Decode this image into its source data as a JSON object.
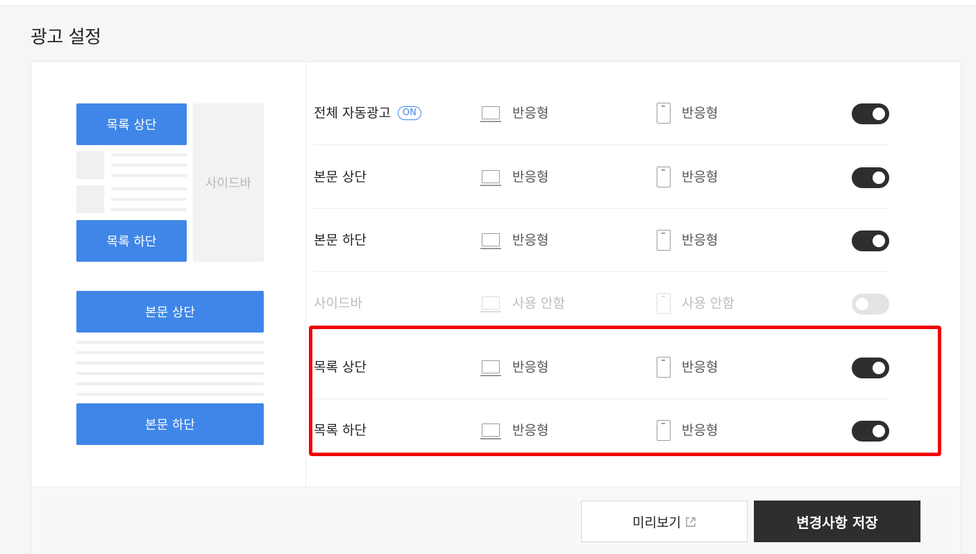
{
  "page": {
    "title": "광고 설정"
  },
  "preview": {
    "list_top": "목록 상단",
    "list_bottom": "목록 하단",
    "sidebar": "사이드바",
    "body_top": "본문 상단",
    "body_bottom": "본문 하단"
  },
  "rows": [
    {
      "name": "전체 자동광고",
      "badge": "ON",
      "pc": "반응형",
      "mobile": "반응형",
      "enabled": true
    },
    {
      "name": "본문 상단",
      "pc": "반응형",
      "mobile": "반응형",
      "enabled": true
    },
    {
      "name": "본문 하단",
      "pc": "반응형",
      "mobile": "반응형",
      "enabled": true
    },
    {
      "name": "사이드바",
      "pc": "사용 안함",
      "mobile": "사용 안함",
      "enabled": false
    },
    {
      "name": "목록 상단",
      "pc": "반응형",
      "mobile": "반응형",
      "enabled": true
    },
    {
      "name": "목록 하단",
      "pc": "반응형",
      "mobile": "반응형",
      "enabled": true
    }
  ],
  "footer": {
    "preview_label": "미리보기",
    "save_label": "변경사항 저장"
  },
  "colors": {
    "accent": "#3f86e8",
    "dark": "#2e2e2e",
    "highlight": "#f20000"
  }
}
